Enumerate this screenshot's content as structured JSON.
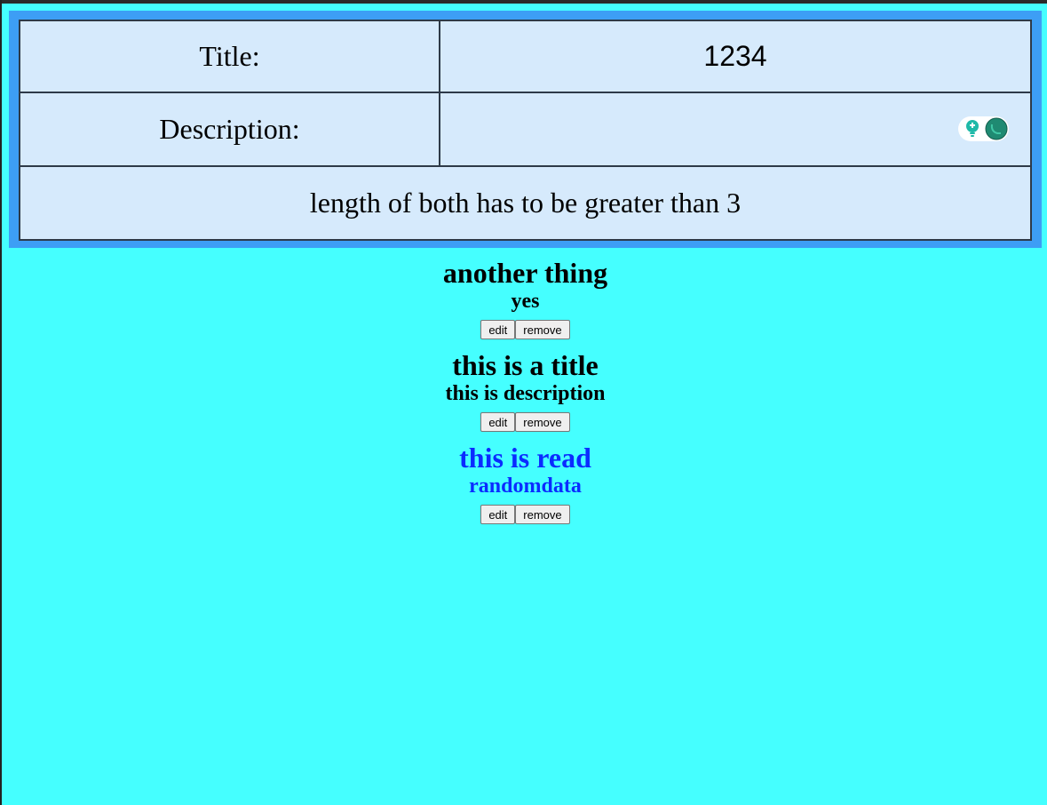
{
  "form": {
    "title_label": "Title:",
    "title_value": "1234",
    "description_label": "Description:",
    "description_value": "",
    "note": "length of both has to be greater than 3",
    "extension_icons": [
      "lightbulb-icon",
      "chat-bubble-icon"
    ]
  },
  "items": [
    {
      "title": "another thing",
      "description": "yes",
      "read": false,
      "edit_label": "edit",
      "remove_label": "remove"
    },
    {
      "title": "this is a title",
      "description": "this is description",
      "read": false,
      "edit_label": "edit",
      "remove_label": "remove"
    },
    {
      "title": "this is read",
      "description": "randomdata",
      "read": true,
      "edit_label": "edit",
      "remove_label": "remove"
    }
  ],
  "colors": {
    "background": "#45ffff",
    "frame": "#3d9ef5",
    "table_bg": "#d6eafc",
    "read_text": "#0b2cff"
  }
}
